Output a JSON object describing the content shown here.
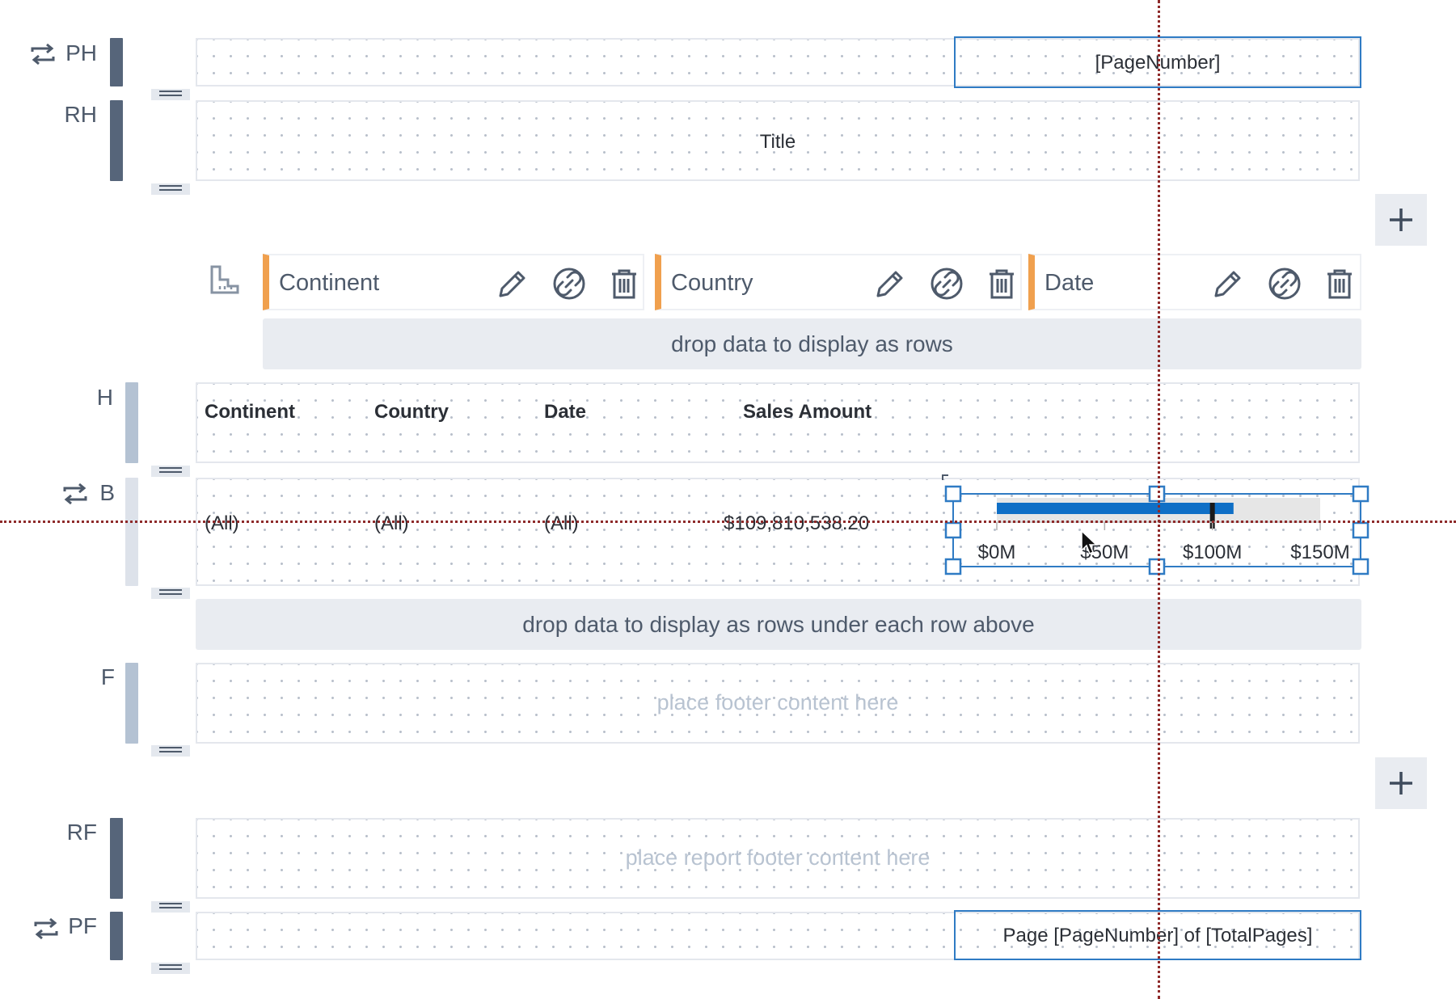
{
  "sections": {
    "page_header": {
      "label": "PH",
      "cell_text": "[PageNumber]"
    },
    "report_header": {
      "label": "RH",
      "cell_text": "Title"
    },
    "header": {
      "label": "H"
    },
    "body": {
      "label": "B"
    },
    "footer": {
      "label": "F",
      "placeholder": "place footer content here"
    },
    "report_footer": {
      "label": "RF",
      "placeholder": "place report footer content here"
    },
    "page_footer": {
      "label": "PF",
      "cell_text": "Page [PageNumber] of [TotalPages]"
    }
  },
  "groups": [
    {
      "label": "Continent"
    },
    {
      "label": "Country"
    },
    {
      "label": "Date"
    }
  ],
  "dropzones": {
    "rows": "drop data to display as rows",
    "subrows": "drop data to display as rows under each row above"
  },
  "table": {
    "headers": [
      "Continent",
      "Country",
      "Date",
      "Sales Amount"
    ],
    "row": [
      "(All)",
      "(All)",
      "(All)",
      "$109,810,538.20"
    ]
  },
  "chart_data": {
    "type": "bar",
    "subtype": "bullet",
    "title": "",
    "xlabel": "",
    "ylabel": "",
    "tick_labels": [
      "$0M",
      "$50M",
      "$100M",
      "$150M"
    ],
    "ticks": [
      0,
      50,
      100,
      150
    ],
    "xlim": [
      0,
      150
    ],
    "value": 109.8,
    "target": 100,
    "range_max": 150,
    "grid": false,
    "colors": {
      "value": "#0f6fc6",
      "range": "#e6e6e6",
      "target": "#1a1a1a"
    }
  },
  "colors": {
    "accent": "#f0a04e",
    "selection": "#2f7bc4",
    "guide": "#8e2a2a"
  },
  "icons": {
    "repeat": "repeat-icon",
    "edit": "pencil-icon",
    "link": "link-icon",
    "delete": "trash-icon",
    "add": "plus-icon",
    "grouping": "grouping-icon"
  }
}
